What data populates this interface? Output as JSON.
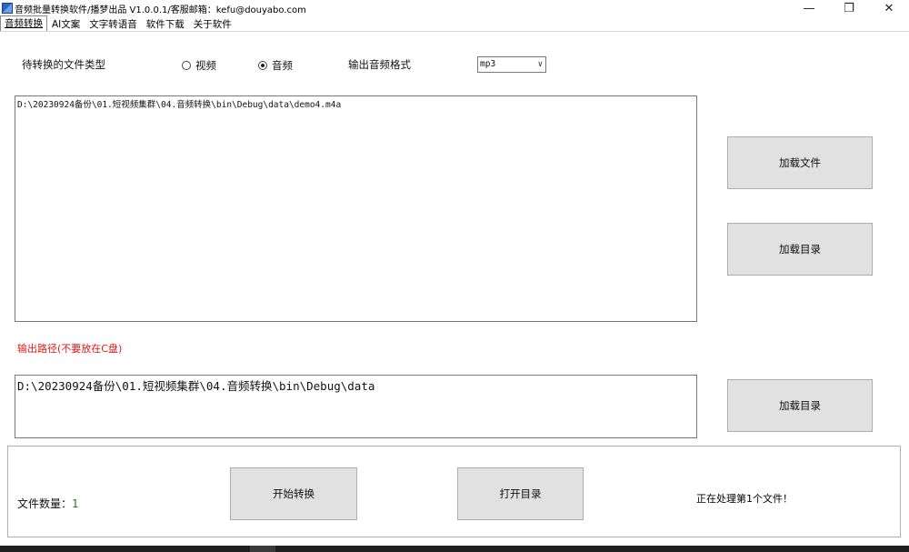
{
  "window": {
    "title": "音频批量转换软件/播梦出品  V1.0.0.1/客服邮箱：kefu@douyabo.com",
    "minimize_icon": "minimize-icon",
    "restore_icon": "restore-icon",
    "close_icon": "close-icon"
  },
  "tabs": [
    {
      "label": "音频转换",
      "active": true
    },
    {
      "label": "AI文案",
      "active": false
    },
    {
      "label": "文字转语音",
      "active": false
    },
    {
      "label": "软件下载",
      "active": false
    },
    {
      "label": "关于软件",
      "active": false
    }
  ],
  "form": {
    "file_type_label": "待转换的文件类型",
    "radio_video_label": "视频",
    "radio_audio_label": "音频",
    "selected_type": "音频",
    "output_format_label": "输出音频格式",
    "output_format_value": "mp3",
    "input_files_text": "D:\\20230924备份\\01.短视频集群\\04.音频转换\\bin\\Debug\\data\\demo4.m4a",
    "load_file_button": "加载文件",
    "load_dir_button": "加载目录",
    "output_path_label": "输出路径(不要放在C盘)",
    "output_path_text": "D:\\20230924备份\\01.短视频集群\\04.音频转换\\bin\\Debug\\data",
    "load_output_dir_button": "加载目录"
  },
  "bottom": {
    "file_count_label": "文件数量：",
    "file_count_value": "1",
    "start_button": "开始转换",
    "open_dir_button": "打开目录",
    "status_text": "正在处理第1个文件！"
  },
  "colors": {
    "red_label": "#e31a1a",
    "count_value": "#1c7a2f",
    "button_bg": "#e1e1e1"
  }
}
